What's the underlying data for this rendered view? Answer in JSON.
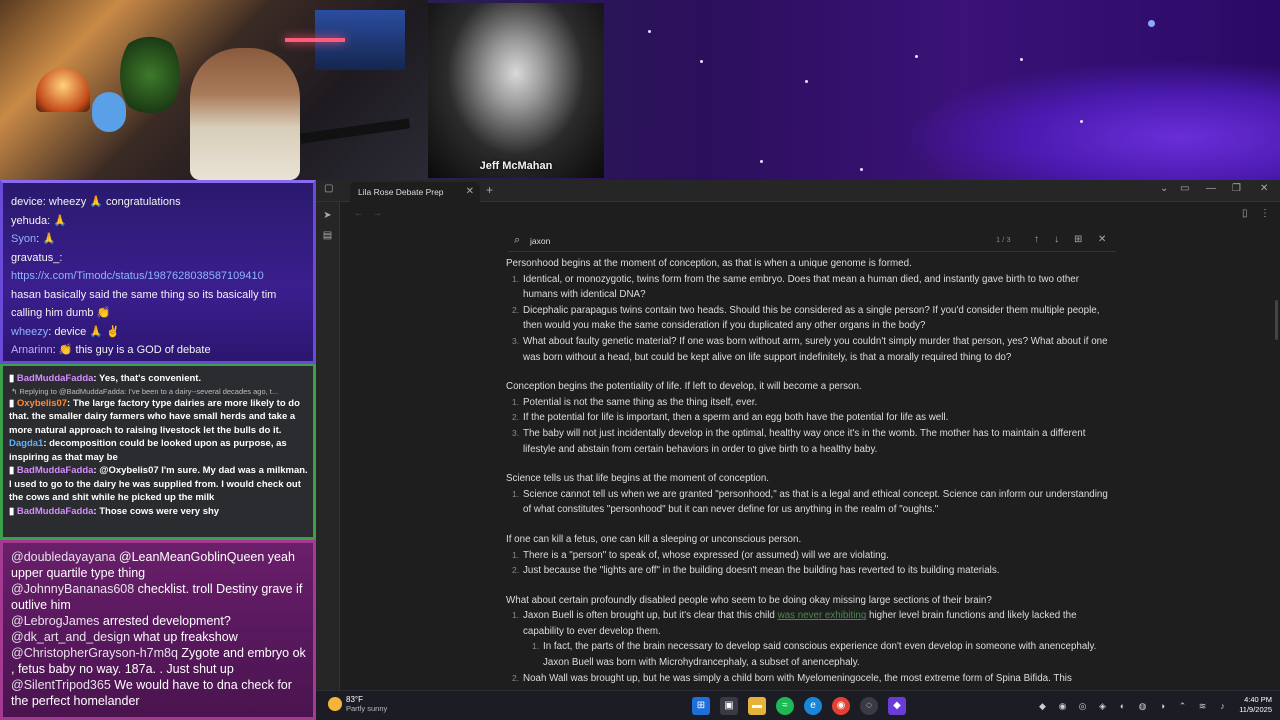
{
  "stream": {
    "portrait_caption": "Jeff McMahan"
  },
  "chat_top": [
    {
      "user": "device",
      "text": ": wheezy 🙏 congratulations"
    },
    {
      "user": "yehuda",
      "text": ": 🙏"
    },
    {
      "user": "Syon",
      "text": ": 🙏"
    },
    {
      "user": "gravatus_",
      "text": ":"
    },
    {
      "user": "",
      "text": "https://x.com/Timodc/status/1987628038587109410"
    },
    {
      "user": "",
      "text": "hasan basically said the same thing so its basically tim"
    },
    {
      "user": "",
      "text": "calling him dumb 👏"
    },
    {
      "user": "wheezy",
      "text": ": device 🙏 ✌"
    },
    {
      "user": "Arnarinn",
      "text": ": 👏 this guy is a GOD of debate"
    }
  ],
  "chat_mid": [
    {
      "user": "BadMuddaFadda",
      "text": ": Yes, that's convenient."
    },
    {
      "reply": "↰ Replying to @BadMuddaFadda: I've been to a dairy--several decades ago, t..."
    },
    {
      "user": "Oxybelis07",
      "text": ": The large factory type dairies are more likely to do that. the smaller dairy farmers who have small herds and take a more natural approach to raising livestock let the bulls do it."
    },
    {
      "user": "Dagda1",
      "text": ": decomposition could be looked upon as purpose, as inspiring as that may be"
    },
    {
      "user": "BadMuddaFadda",
      "text": ": @Oxybelis07 I'm sure. My dad was a milkman. I used to go to the dairy he was supplied from. I would check out the cows and shit while he picked up the milk"
    },
    {
      "user": "BadMuddaFadda",
      "text": ": Those cows were very shy"
    }
  ],
  "chat_bottom": [
    {
      "user": "@doubledayayana",
      "text": " @LeanMeanGoblinQueen yeah upper quartile type thing"
    },
    {
      "user": "@JohnnyBananas608",
      "text": " checklist. troll Destiny grave if outlive him"
    },
    {
      "user": "@LebrogJames",
      "text": " arrested development?"
    },
    {
      "user": "@dk_art_and_design",
      "text": " what up freakshow"
    },
    {
      "user": "@ChristopherGrayson-h7m8q",
      "text": " Zygote and embryo ok , fetus baby no way. 187a. . Just shut up"
    },
    {
      "user": "@SilentTripod365",
      "text": " We would have to dna check for the perfect homelander"
    }
  ],
  "obsidian": {
    "tab_title": "Lila Rose Debate Prep",
    "search_value": "jaxon",
    "search_count": "1 / 3",
    "doc": {
      "s1_title": "Personhood begins at the moment of conception, as that is when a unique genome is formed.",
      "s1_items": [
        "Identical, or monozygotic, twins form from the same embryo. Does that mean a human died, and instantly gave birth to two other humans with identical DNA?",
        "Dicephalic parapagus twins contain two heads. Should this be considered as a single person? If you'd consider them multiple people, then would you make the same consideration if you duplicated any other organs in the body?",
        "What about faulty genetic material? If one was born without arm, surely you couldn't simply murder that person, yes? What about if one was born without a head, but could be kept alive on life support indefinitely, is that a morally required thing to do?"
      ],
      "s2_title": "Conception begins the potentiality of life. If left to develop, it will become a person.",
      "s2_items": [
        "Potential is not the same thing as the thing itself, ever.",
        "If the potential for life is important, then a sperm and an egg both have the potential for life as well.",
        "The baby will not just incidentally develop in the optimal, healthy way once it's in the womb. The mother has to maintain a different lifestyle and abstain from certain behaviors in order to give birth to a healthy baby."
      ],
      "s3_title": "Science tells us that life begins at the moment of conception.",
      "s3_items": [
        "Science cannot tell us when we are granted \"personhood,\" as that is a legal and ethical concept. Science can inform our understanding of what constitutes \"personhood\" but it can never define for us anything in the realm of \"oughts.\""
      ],
      "s4_title": "If one can kill a fetus, one can kill a sleeping or unconscious person.",
      "s4_items": [
        "There is a \"person\" to speak of, whose expressed (or assumed) will we are violating.",
        "Just because the \"lights are off\" in the building doesn't mean the building has reverted to its building materials."
      ],
      "s5_title": "What about certain profoundly disabled people who seem to be doing okay missing large sections of their brain?",
      "s5_item1_a": "Jaxon Buell is often brought up, but it's clear that this child ",
      "s5_item1_link": "was never exhibiting",
      "s5_item1_b": " higher level brain functions and likely lacked the capability to ever develop them.",
      "s5_sub1": "In fact, the parts of the brain necessary to develop said conscious experience don't even develop in someone with anencephaly. Jaxon Buell was born with Microhydrancephaly, a subset of anencephaly.",
      "s5_item2": "Noah Wall was brought up, but he was simply a child born with Myelomeningocele, the most extreme form of Spina Bifida. This"
    }
  },
  "taskbar": {
    "temp": "83°F",
    "weather": "Partly sunny",
    "time": "4:40 PM",
    "date": "11/9/2025"
  }
}
